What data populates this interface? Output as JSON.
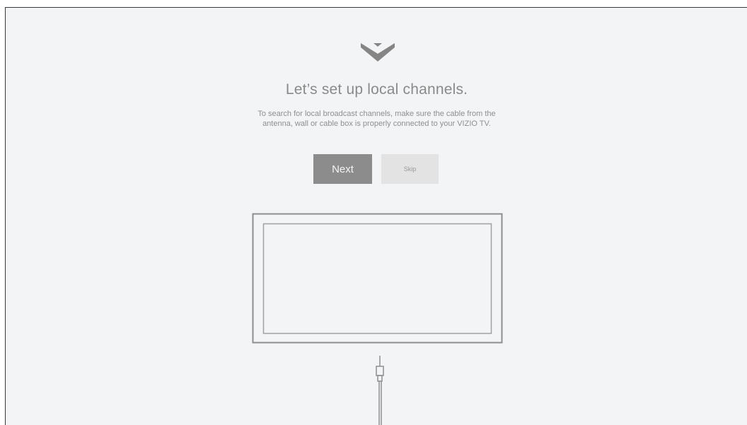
{
  "setup": {
    "title": "Let’s set up local channels.",
    "description_line1": "To search for local broadcast channels, make sure the cable from the",
    "description_line2": "antenna, wall or cable box is properly connected to your VIZIO TV.",
    "next_label": "Next",
    "skip_label": "Skip"
  },
  "icons": {
    "logo": "vizio-v-logo-icon",
    "illustration": "tv-with-coax-cable-icon"
  },
  "colors": {
    "background": "#f3f4f5",
    "next_button": "#8c8c8c",
    "skip_button": "#e3e3e3",
    "text": "#8a8a8a"
  }
}
